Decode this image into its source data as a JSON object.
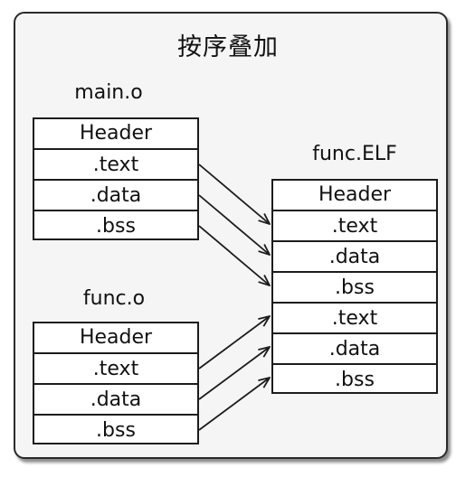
{
  "title": "按序叠加",
  "main": {
    "label": "main.o",
    "sections": [
      "Header",
      ".text",
      ".data",
      ".bss"
    ]
  },
  "func": {
    "label": "func.o",
    "sections": [
      "Header",
      ".text",
      ".data",
      ".bss"
    ]
  },
  "elf": {
    "label": "func.ELF",
    "sections": [
      "Header",
      ".text",
      ".data",
      ".bss",
      ".text",
      ".data",
      ".bss"
    ]
  }
}
